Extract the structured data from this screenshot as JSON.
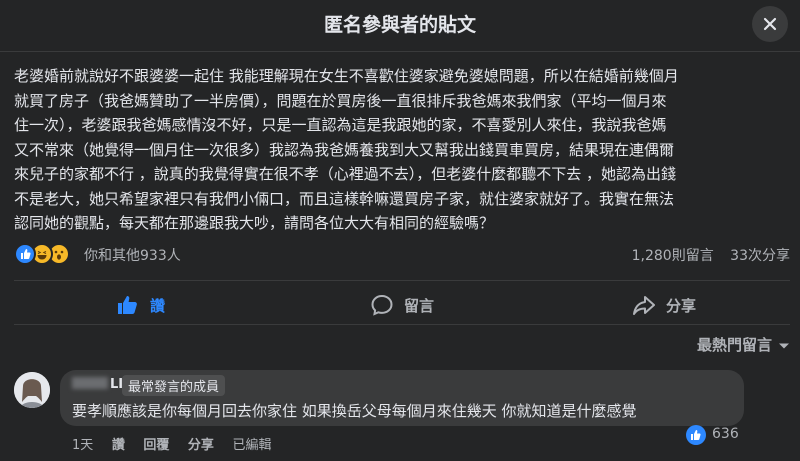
{
  "header": {
    "title": "匿名參與者的貼文",
    "close_icon": "close-icon"
  },
  "post": {
    "lines": [
      "老婆婚前就說好不跟婆婆一起住  我能理解現在女生不喜歡住婆家避免婆媳問題，所以在結婚前幾個月",
      "就買了房子（我爸媽贊助了一半房價），問題在於買房後一直很排斥我爸媽來我們家（平均一個月來",
      "住一次），老婆跟我爸媽感情沒不好，只是一直認為這是我跟她的家，不喜愛別人來住，我說我爸媽",
      "又不常來（她覺得一個月住一次很多）我認為我爸媽養我到大又幫我出錢買車買房，結果現在連偶爾",
      "來兒子的家都不行 ，說真的我覺得實在很不孝（心裡過不去），但老婆什麼都聽不下去 ，她認為出錢",
      "不是老大，她只希望家裡只有我們小倆口，而且這樣幹嘛還買房子家，就住婆家就好了。我實在無法",
      "認同她的觀點，每天都在那邊跟我大吵，請問各位大大有相同的經驗嗎？"
    ],
    "reactions": {
      "icons": [
        "like-icon",
        "haha-icon",
        "wow-icon"
      ],
      "summary": "你和其他933人"
    },
    "stats": {
      "comments": "1,280則留言",
      "shares": "33次分享"
    }
  },
  "actions": {
    "like": "讚",
    "comment": "留言",
    "share": "分享"
  },
  "comments_sort": {
    "label": "最熱門留言"
  },
  "comment": {
    "author_visible": "LI",
    "badge": "最常發言的成員",
    "text": "要孝順應該是你每個月回去你家住 如果換岳父母每個月來住幾天 你就知道是什麼感覺",
    "time": "1天",
    "like": "讚",
    "reply": "回覆",
    "share": "分享",
    "edited": "已編輯",
    "reaction_count": "636"
  },
  "colors": {
    "background": "#242526",
    "bubble": "#3a3b3c",
    "like_blue": "#2d88ff",
    "text": "#e4e6eb",
    "muted": "#b0b3b8"
  }
}
